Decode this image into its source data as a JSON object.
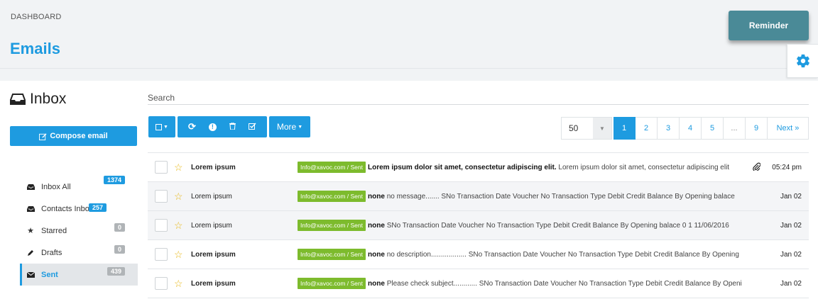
{
  "header": {
    "breadcrumb": "DASHBOARD",
    "title": "Emails",
    "reminder_label": "Reminder"
  },
  "sidebar": {
    "heading": "Inbox",
    "compose_label": "Compose email",
    "items": [
      {
        "label": "Inbox All",
        "badge": "1374",
        "icon": "inbox-icon"
      },
      {
        "label": "Contacts Inbox",
        "badge": "257",
        "icon": "inbox-icon"
      },
      {
        "label": "Starred",
        "badge": "0",
        "icon": "star-icon"
      },
      {
        "label": "Drafts",
        "badge": "0",
        "icon": "pencil-icon"
      },
      {
        "label": "Sent",
        "badge": "439",
        "icon": "envelope-icon"
      }
    ]
  },
  "search": {
    "placeholder": "Search"
  },
  "toolbar": {
    "more_label": "More"
  },
  "pagination": {
    "per_page": "50",
    "pages": [
      "1",
      "2",
      "3",
      "4",
      "5",
      "...",
      "9"
    ],
    "next_label": "Next »",
    "current": "1"
  },
  "emails": [
    {
      "sender": "Lorem ipsum",
      "label": "Info@xavoc.com / Sent",
      "subject": "Lorem ipsum dolor sit amet, consectetur adipiscing elit.",
      "preview": "Lorem ipsum dolor sit amet, consectetur adipiscing elit",
      "date": "05:24 pm",
      "attachment": true
    },
    {
      "sender": "Lorem ipsum",
      "label": "Info@xavoc.com / Sent",
      "subject": "none",
      "preview": "no message....... SNo Transaction Date Voucher No Transaction Type Debit Credit Balance By Opening balace",
      "date": "Jan 02",
      "attachment": false
    },
    {
      "sender": "Lorem ipsum",
      "label": "Info@xavoc.com / Sent",
      "subject": "none",
      "preview": "SNo Transaction Date Voucher No Transaction Type Debit Credit Balance By Opening balace 0 1 11/06/2016",
      "date": "Jan 02",
      "attachment": false
    },
    {
      "sender": "Lorem ipsum",
      "label": "Info@xavoc.com / Sent",
      "subject": "none",
      "preview": "no description.................. SNo Transaction Date Voucher No Transaction Type Debit Credit Balance By Opening",
      "date": "Jan 02",
      "attachment": false
    },
    {
      "sender": "Lorem ipsum",
      "label": "Info@xavoc.com / Sent",
      "subject": "none",
      "preview": "Please check subject............ SNo Transaction Date Voucher No Transaction Type Debit Credit Balance By Opening",
      "date": "Jan 02",
      "attachment": false
    }
  ],
  "colors": {
    "accent": "#1e9be0",
    "label_green": "#7dbb2d",
    "reminder": "#4a8a97"
  }
}
